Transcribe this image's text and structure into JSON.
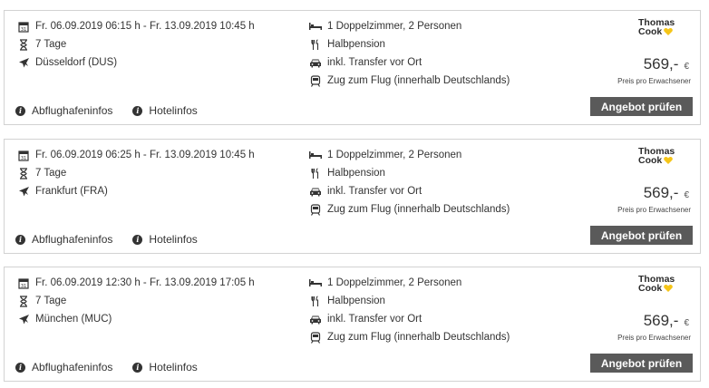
{
  "offers": [
    {
      "dates": "Fr. 06.09.2019 06:15 h - Fr. 13.09.2019 10:45 h",
      "duration": "7 Tage",
      "airport": "Düsseldorf (DUS)",
      "room": "1 Doppelzimmer, 2 Personen",
      "board": "Halbpension",
      "transfer": "inkl. Transfer vor Ort",
      "train": "Zug zum Flug (innerhalb Deutschlands)",
      "price": "569,-",
      "currency": "€",
      "price_note": "Preis pro Erwachsener",
      "airport_info": "Abflughafeninfos",
      "hotel_info": "Hotelinfos",
      "cta": "Angebot prüfen",
      "brand_line1": "Thomas",
      "brand_line2": "Cook"
    },
    {
      "dates": "Fr. 06.09.2019 06:25 h - Fr. 13.09.2019 10:45 h",
      "duration": "7 Tage",
      "airport": "Frankfurt (FRA)",
      "room": "1 Doppelzimmer, 2 Personen",
      "board": "Halbpension",
      "transfer": "inkl. Transfer vor Ort",
      "train": "Zug zum Flug (innerhalb Deutschlands)",
      "price": "569,-",
      "currency": "€",
      "price_note": "Preis pro Erwachsener",
      "airport_info": "Abflughafeninfos",
      "hotel_info": "Hotelinfos",
      "cta": "Angebot prüfen",
      "brand_line1": "Thomas",
      "brand_line2": "Cook"
    },
    {
      "dates": "Fr. 06.09.2019 12:30 h - Fr. 13.09.2019 17:05 h",
      "duration": "7 Tage",
      "airport": "München (MUC)",
      "room": "1 Doppelzimmer, 2 Personen",
      "board": "Halbpension",
      "transfer": "inkl. Transfer vor Ort",
      "train": "Zug zum Flug (innerhalb Deutschlands)",
      "price": "569,-",
      "currency": "€",
      "price_note": "Preis pro Erwachsener",
      "airport_info": "Abflughafeninfos",
      "hotel_info": "Hotelinfos",
      "cta": "Angebot prüfen",
      "brand_line1": "Thomas",
      "brand_line2": "Cook"
    }
  ],
  "colors": {
    "button_bg": "#5a5a5a",
    "border": "#d2d2d2",
    "brand_heart": "#f5c518",
    "text": "#333333"
  },
  "icons": {
    "calendar": "calendar-icon",
    "duration": "hourglass-icon",
    "airport": "airplane-icon",
    "room": "bed-icon",
    "board": "cutlery-icon",
    "transfer": "car-icon",
    "train": "train-icon",
    "info": "info-icon"
  }
}
